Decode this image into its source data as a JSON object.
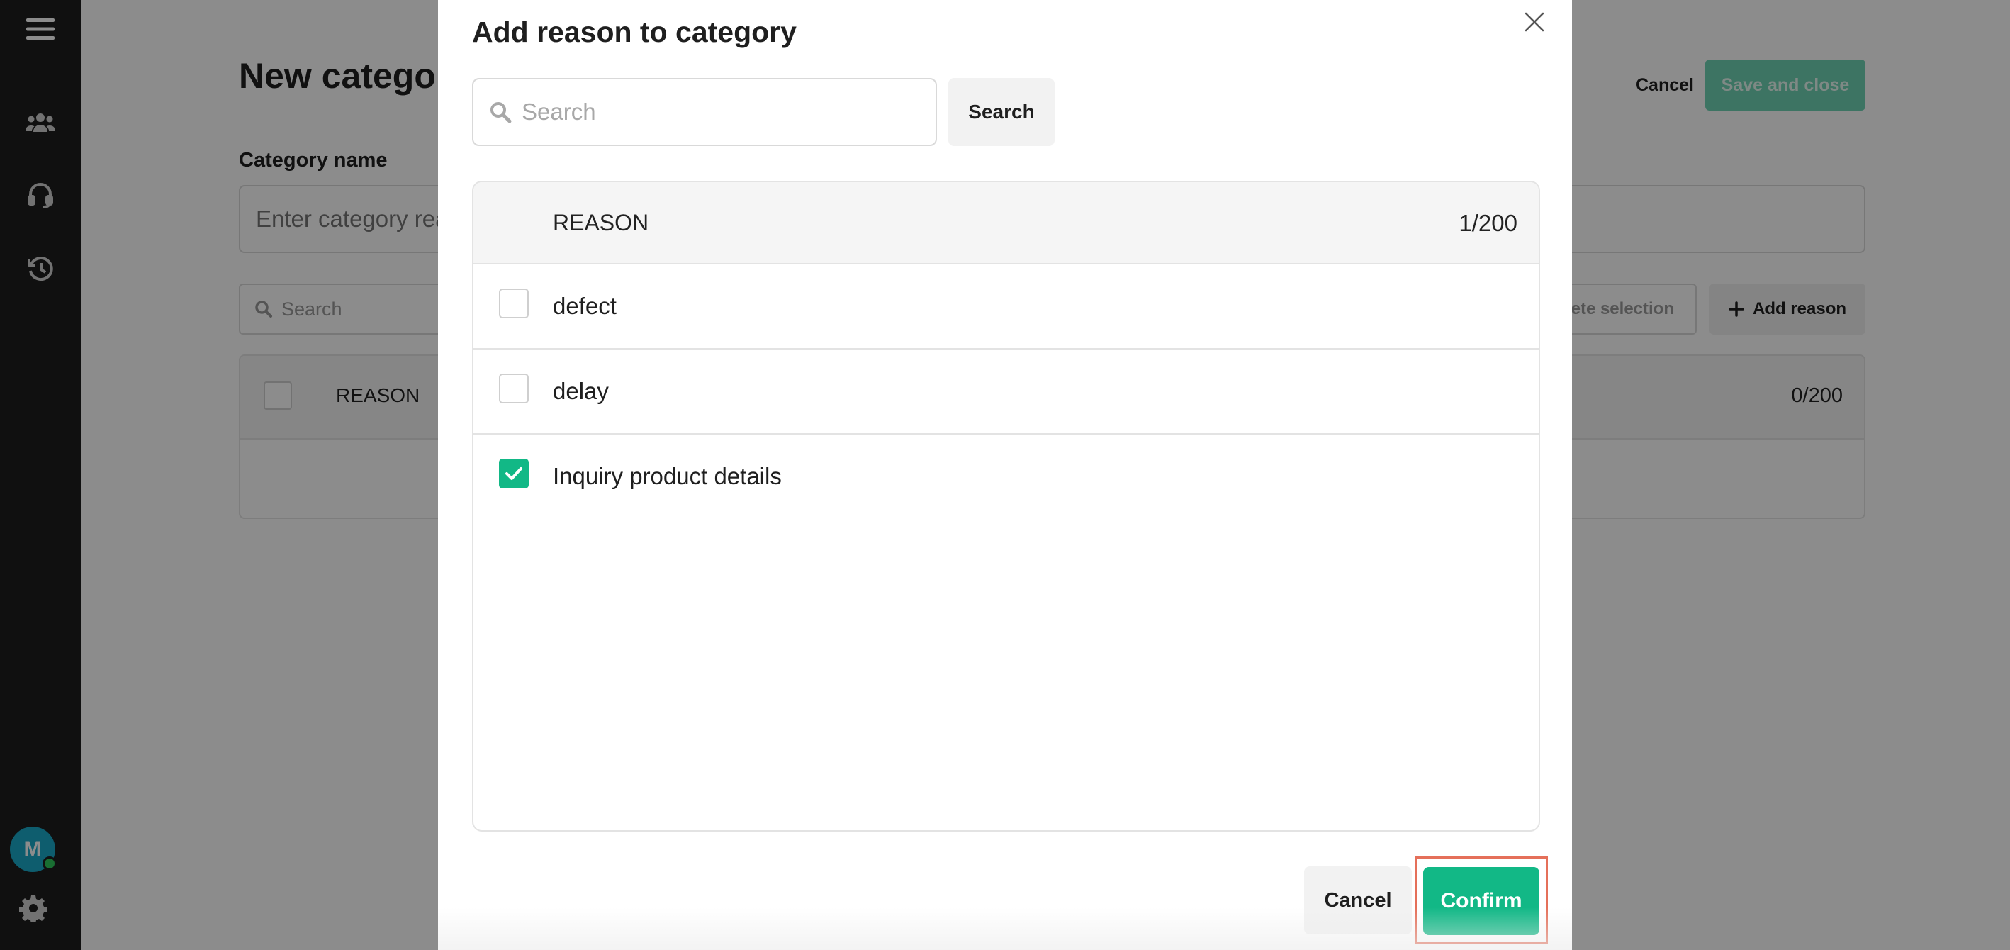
{
  "page": {
    "title": "New category",
    "header_cancel": "Cancel",
    "header_save": "Save and close",
    "category_name_label": "Category name",
    "category_name_placeholder": "Enter category reason",
    "list_search_placeholder": "Search",
    "delete_selection_label": "Delete selection",
    "add_reason_label": "Add reason",
    "table_column": "REASON",
    "table_count": "0/200"
  },
  "sidebar": {
    "icons": [
      "menu-icon",
      "users-icon",
      "headset-icon",
      "history-icon",
      "gear-icon"
    ],
    "avatar_initial": "M",
    "status_color": "#2ec95c"
  },
  "modal": {
    "title": "Add reason to category",
    "search_placeholder": "Search",
    "search_button": "Search",
    "column_header": "REASON",
    "selection_count": "1/200",
    "rows": [
      {
        "label": "defect",
        "checked": false
      },
      {
        "label": "delay",
        "checked": false
      },
      {
        "label": "Inquiry product details",
        "checked": true
      }
    ],
    "cancel_label": "Cancel",
    "confirm_label": "Confirm"
  },
  "colors": {
    "accent": "#12b886",
    "accent_disabled": "#6fd3b5",
    "sidebar_bg": "#1e1e1e",
    "avatar_bg": "#1aa9c9",
    "highlight": "#e5705a"
  }
}
